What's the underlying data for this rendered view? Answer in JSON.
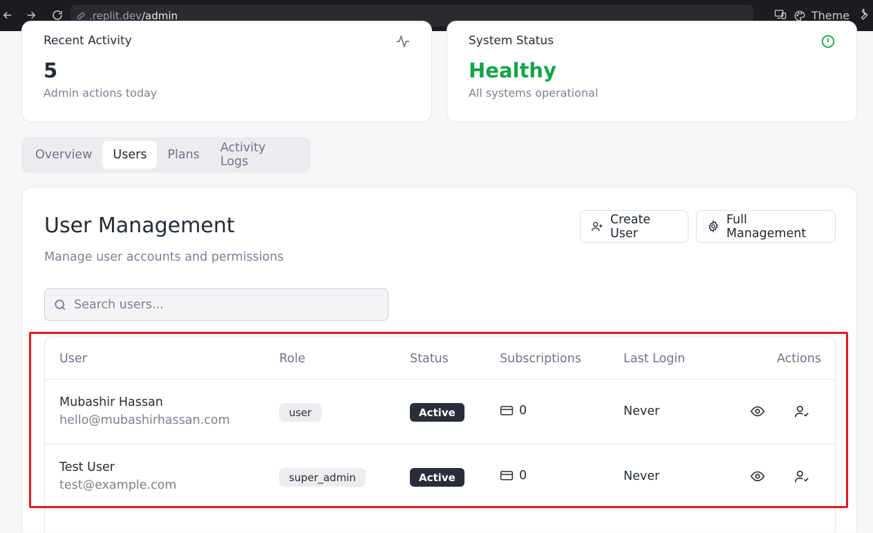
{
  "browser": {
    "url_host": ".replit.dev",
    "url_path": "/admin",
    "theme_label": "Theme"
  },
  "stats": {
    "recent_activity": {
      "title": "Recent Activity",
      "value": "5",
      "subtitle": "Admin actions today"
    },
    "system_status": {
      "title": "System Status",
      "value": "Healthy",
      "subtitle": "All systems operational",
      "value_color": "#16a34a"
    }
  },
  "tabs": [
    {
      "label": "Overview",
      "active": false
    },
    {
      "label": "Users",
      "active": true
    },
    {
      "label": "Plans",
      "active": false
    },
    {
      "label": "Activity Logs",
      "active": false
    }
  ],
  "user_management": {
    "title": "User Management",
    "description": "Manage user accounts and permissions",
    "create_user_label": "Create User",
    "full_management_label": "Full Management",
    "search_placeholder": "Search users..."
  },
  "table": {
    "headers": [
      "User",
      "Role",
      "Status",
      "Subscriptions",
      "Last Login",
      "Actions"
    ],
    "rows": [
      {
        "name": "Mubashir Hassan",
        "email": "hello@mubashirhassan.com",
        "role": "user",
        "status": "Active",
        "subscriptions": "0",
        "last_login": "Never"
      },
      {
        "name": "Test User",
        "email": "test@example.com",
        "role": "super_admin",
        "status": "Active",
        "subscriptions": "0",
        "last_login": "Never"
      }
    ]
  },
  "colors": {
    "accent_dark": "#2a2d3a",
    "healthy_green": "#16a34a",
    "highlight_red": "#e5161c"
  }
}
